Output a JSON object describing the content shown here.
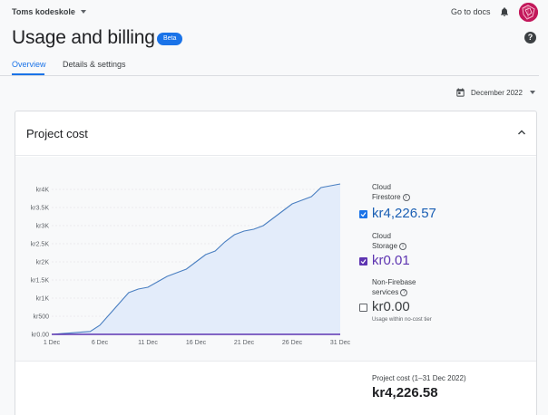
{
  "header": {
    "project_name": "Toms kodeskole",
    "go_to_docs": "Go to docs"
  },
  "page": {
    "title": "Usage and billing",
    "badge": "Beta",
    "help": "?"
  },
  "tabs": [
    {
      "label": "Overview",
      "active": true
    },
    {
      "label": "Details & settings",
      "active": false
    }
  ],
  "date_selector": {
    "value": "December 2022"
  },
  "card": {
    "title": "Project cost",
    "legend": [
      {
        "name_line1": "Cloud",
        "name_line2": "Firestore",
        "value": "kr4,226.57",
        "checked": true,
        "color": "#1a73e8"
      },
      {
        "name_line1": "Cloud",
        "name_line2": "Storage",
        "value": "kr0.01",
        "checked": true,
        "color": "#5e35b1"
      },
      {
        "name_line1": "Non-Firebase",
        "name_line2": "services",
        "value": "kr0.00",
        "checked": false,
        "note": "Usage within no-cost tier"
      }
    ],
    "footer_label": "Project cost (1–31 Dec 2022)",
    "footer_value": "kr4,226.58"
  },
  "chart_data": {
    "type": "area",
    "x_ticks": [
      "1 Dec",
      "6 Dec",
      "11 Dec",
      "16 Dec",
      "21 Dec",
      "26 Dec",
      "31 Dec"
    ],
    "y_ticks": [
      "kr0.00",
      "kr500",
      "kr1K",
      "kr1.5K",
      "kr2K",
      "kr2.5K",
      "kr3K",
      "kr3.5K",
      "kr4K"
    ],
    "ylim": [
      0,
      4000
    ],
    "xlim": [
      1,
      31
    ],
    "series": [
      {
        "name": "Cloud Firestore",
        "color": "#4a7fc1",
        "x": [
          1,
          2,
          3,
          4,
          5,
          6,
          7,
          8,
          9,
          10,
          11,
          12,
          13,
          14,
          15,
          16,
          17,
          18,
          19,
          20,
          21,
          22,
          23,
          24,
          25,
          26,
          27,
          28,
          29,
          30,
          31
        ],
        "values": [
          0,
          20,
          40,
          60,
          80,
          250,
          550,
          850,
          1150,
          1250,
          1300,
          1450,
          1600,
          1700,
          1800,
          2000,
          2200,
          2300,
          2550,
          2750,
          2850,
          2900,
          3000,
          3200,
          3400,
          3600,
          3700,
          3800,
          4050,
          4100,
          4150
        ]
      },
      {
        "name": "Cloud Storage",
        "color": "#5e35b1",
        "x": [
          1,
          31
        ],
        "values": [
          0,
          0
        ]
      }
    ]
  }
}
